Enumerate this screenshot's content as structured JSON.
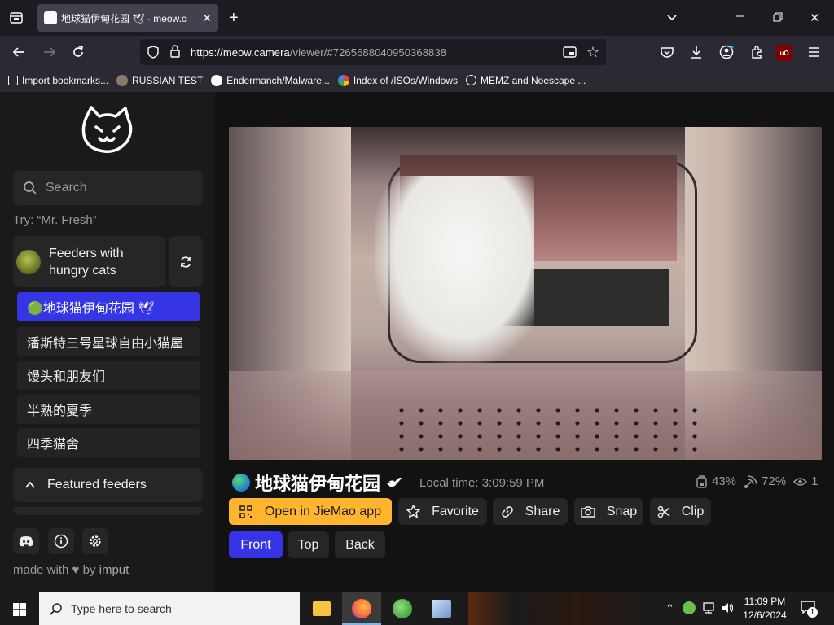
{
  "browser": {
    "tab_title": "地球猫伊甸花园 🕊 · meow.c",
    "url_host": "https://meow.camera",
    "url_path": "/viewer/#7265688040950368838",
    "bookmarks": [
      {
        "label": "Import bookmarks...",
        "icon": "import-icon"
      },
      {
        "label": "RUSSIAN TEST",
        "icon": "ghost-icon"
      },
      {
        "label": "Endermanch/Malware...",
        "icon": "github-icon"
      },
      {
        "label": "Index of /ISOs/Windows",
        "icon": "google-icon"
      },
      {
        "label": "MEMZ and Noescape ...",
        "icon": "globe-icon"
      }
    ],
    "accent": "#2b2a33"
  },
  "sidebar": {
    "search_placeholder": "Search",
    "hint": "Try: “Mr. Fresh”",
    "feeder_group": "Feeders with hungry cats",
    "cameras": [
      {
        "label": "🟢地球猫伊甸花园 🕊",
        "active": true
      },
      {
        "label": "潘斯特三号星球自由小猫屋",
        "active": false
      },
      {
        "label": "馒头和朋友们",
        "active": false
      },
      {
        "label": "半熟的夏季",
        "active": false
      },
      {
        "label": "四季猫舍",
        "active": false
      }
    ],
    "featured_label": "Featured feeders",
    "footer_made": "made with",
    "footer_by": "by",
    "footer_link": "imput"
  },
  "viewer": {
    "title": "地球猫伊甸花园",
    "local_time": "Local time: 3:09:59 PM",
    "stats": {
      "food": "43%",
      "signal": "72%",
      "viewers": "1"
    },
    "actions": {
      "open_app": "Open in JieMao app",
      "favorite": "Favorite",
      "share": "Share",
      "snap": "Snap",
      "clip": "Clip"
    },
    "views": [
      "Front",
      "Top",
      "Back"
    ],
    "active_view": "Front",
    "accent_yellow": "#ffb52e",
    "accent_blue": "#3535e6"
  },
  "taskbar": {
    "search_placeholder": "Type here to search",
    "time": "11:09 PM",
    "date": "12/6/2024",
    "notifications": "1"
  }
}
